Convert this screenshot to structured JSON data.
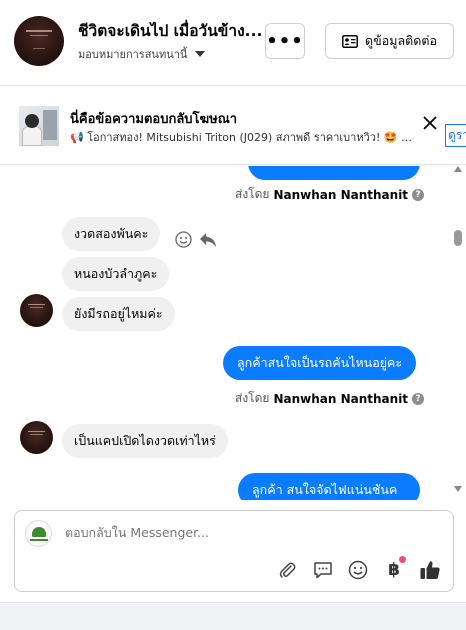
{
  "header": {
    "title": "ชีวิตจะเดินไป เมื่อวันข้าง...",
    "assignee": "มอบหมายการสนทนานี้",
    "more_label": "•••",
    "contact_label": "ดูข้อมูลติดต่อ"
  },
  "ad": {
    "title": "นี่คือข้อความตอบกลับโฆษณา",
    "text": "📢 โอกาสทอง! Mitsubishi Triton (J029) สภาพดี ราคาเบาหวิว! 🤩 กำลั...",
    "link_label": "ดูรา"
  },
  "conversation": {
    "sent_by_prefix": "ส่งโดย",
    "sender_name": "Nanwhan Nanthanit",
    "messages": [
      {
        "text": "งวดสองพันคะ"
      },
      {
        "text": "หนองบัวลำภูคะ"
      },
      {
        "text": "ยังมีรถอยู่ไหมค่ะ"
      },
      {
        "text": "ลูกค้าสนใจเป็นรถคันไหนอยู่คะ"
      },
      {
        "text": "เป็นแคปเปิดไดงวดเท่าไหร่"
      },
      {
        "text": "ลูกค้า สนใจจัดไฟแน่นชันค"
      }
    ]
  },
  "composer": {
    "placeholder": "ตอบกลับใน Messenger...",
    "baht_symbol": "฿"
  },
  "colors": {
    "accent": "#0a7cff",
    "incoming_bubble": "#f0f0f0",
    "notification": "#f0506e"
  },
  "icons": {
    "more": "ellipsis-icon",
    "contact": "contact-card-icon",
    "close": "close-icon",
    "emoji": "smiley-icon",
    "reply": "reply-arrow-icon",
    "attach": "paperclip-icon",
    "saved_replies": "chat-bubble-icon",
    "emoji_picker": "smiley-icon",
    "payment": "baht-icon",
    "like": "thumbs-up-icon"
  }
}
